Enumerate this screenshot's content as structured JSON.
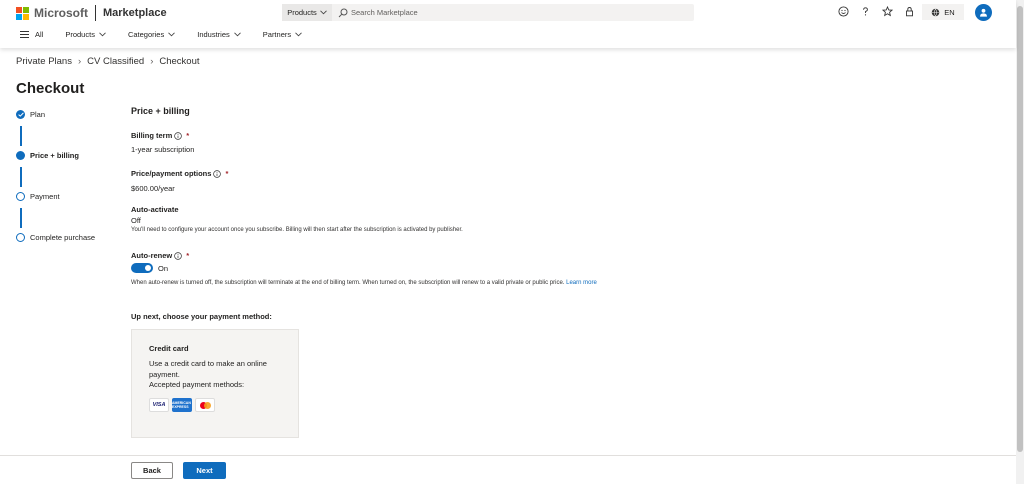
{
  "header": {
    "brand": "Microsoft",
    "product": "Marketplace",
    "search_category": "Products",
    "search_placeholder": "Search Marketplace",
    "language": "EN"
  },
  "nav": {
    "all": "All",
    "items": [
      "Products",
      "Categories",
      "Industries",
      "Partners"
    ]
  },
  "breadcrumb": [
    "Private Plans",
    "CV Classified",
    "Checkout"
  ],
  "page_title": "Checkout",
  "steps": [
    {
      "label": "Plan",
      "state": "done"
    },
    {
      "label": "Price + billing",
      "state": "current"
    },
    {
      "label": "Payment",
      "state": "todo"
    },
    {
      "label": "Complete purchase",
      "state": "todo"
    }
  ],
  "price_billing": {
    "section_title": "Price + billing",
    "billing_term_label": "Billing term",
    "billing_term_value": "1-year subscription",
    "price_label": "Price/payment options",
    "price_value": "$600.00/year",
    "auto_activate_label": "Auto-activate",
    "auto_activate_value": "Off",
    "auto_activate_hint": "You'll need to configure your account once you subscribe. Billing will then start after the subscription is activated by publisher.",
    "auto_renew_label": "Auto-renew",
    "auto_renew_state": "On",
    "auto_renew_hint": "When auto-renew is turned off, the subscription will terminate at the end of billing term. When turned on, the subscription will renew to a valid private or public price.",
    "learn_more": "Learn more",
    "required_marker": "*"
  },
  "payment": {
    "heading": "Up next, choose your payment method:",
    "card_title": "Credit card",
    "card_desc": "Use a credit card to make an online payment.",
    "card_accepted": "Accepted payment methods:",
    "visa": "VISA",
    "amex": "AMERICAN EXPRESS"
  },
  "footer": {
    "back": "Back",
    "next": "Next"
  },
  "colors": {
    "accent": "#0f6cbd"
  }
}
